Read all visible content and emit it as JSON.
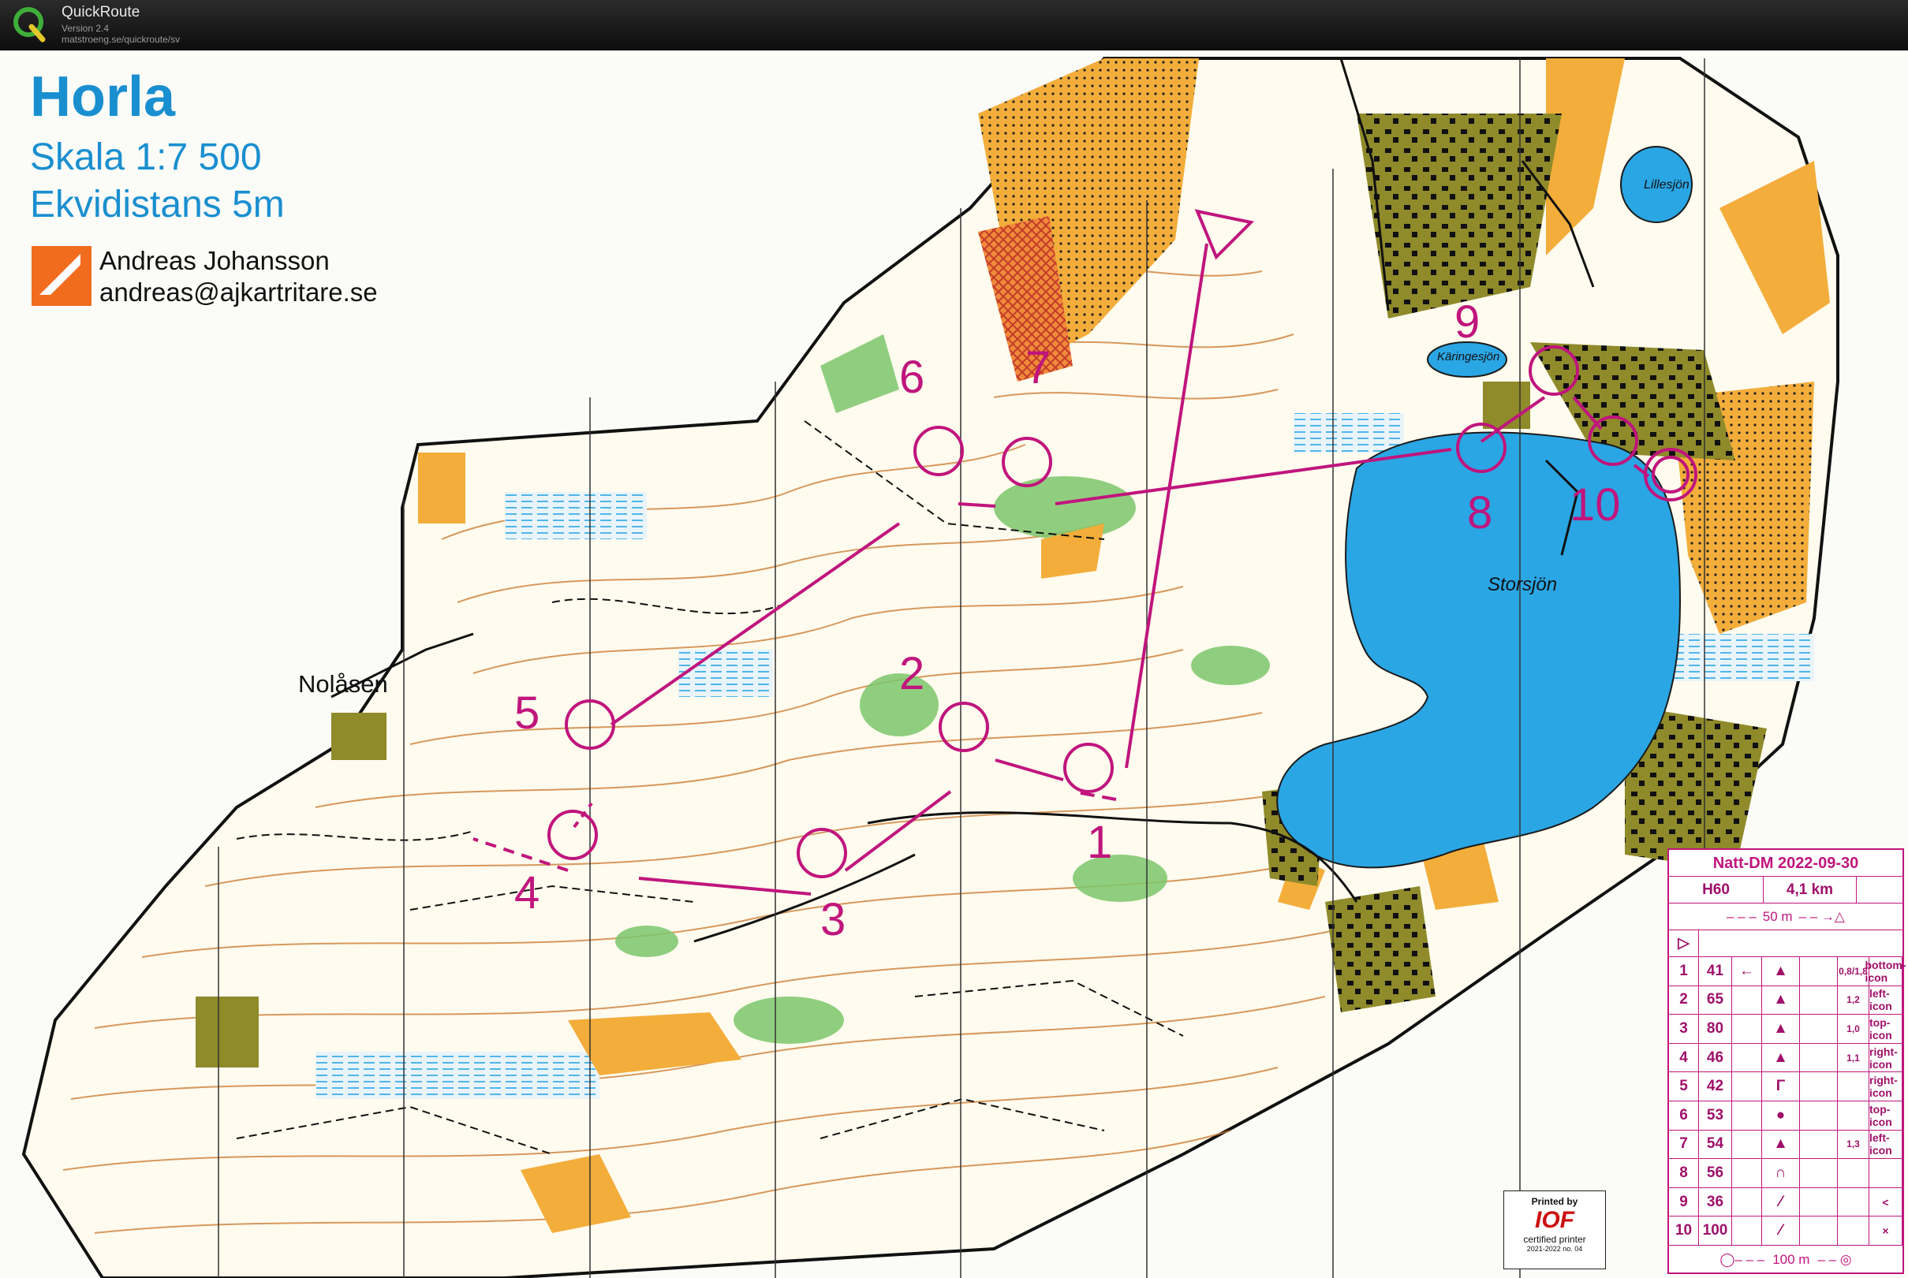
{
  "app": {
    "name": "QuickRoute",
    "version": "Version 2.4",
    "url": "matstroeng.se/quickroute/sv",
    "logo_icon": "quickroute-q-logo-icon"
  },
  "map": {
    "title": "Horla",
    "scale": "Skala 1:7 500",
    "contour_interval": "Ekvidistans 5m",
    "mapper_name": "Andreas Johansson",
    "mapper_email": "andreas@ajkartritare.se",
    "places": {
      "nolasen": "Nolåsen",
      "storsjon": "Storsjön",
      "lillesjon": "Lillesjön",
      "karringesjon": "Käringesjön"
    },
    "colors": {
      "course": "#c0157d",
      "lake": "#2aa6e4",
      "open_land": "#f2a52e",
      "vegetation": "#7cc66b",
      "contour": "#c9782d",
      "settlement": "#8f8a2a"
    },
    "controls": [
      "1",
      "2",
      "3",
      "4",
      "5",
      "6",
      "7",
      "8",
      "9",
      "10"
    ]
  },
  "description_sheet": {
    "event": "Natt-DM 2022-09-30",
    "class": "H60",
    "length": "4,1 km",
    "start_tape": "50 m",
    "finish_tape": "100 m",
    "rows": [
      {
        "num": "1",
        "code": "41",
        "dir": "←",
        "feature": "▲",
        "dim": "0,8/1,8",
        "pos": "bottom-icon"
      },
      {
        "num": "2",
        "code": "65",
        "dir": "",
        "feature": "▲",
        "dim": "1,2",
        "pos": "left-icon"
      },
      {
        "num": "3",
        "code": "80",
        "dir": "",
        "feature": "▲",
        "dim": "1,0",
        "pos": "top-icon"
      },
      {
        "num": "4",
        "code": "46",
        "dir": "",
        "feature": "▲",
        "dim": "1,1",
        "pos": "right-icon"
      },
      {
        "num": "5",
        "code": "42",
        "dir": "",
        "feature": "Γ",
        "dim": "",
        "pos": "right-icon"
      },
      {
        "num": "6",
        "code": "53",
        "dir": "",
        "feature": "●",
        "dim": "",
        "pos": "top-icon"
      },
      {
        "num": "7",
        "code": "54",
        "dir": "",
        "feature": "▲",
        "dim": "1,3",
        "pos": "left-icon"
      },
      {
        "num": "8",
        "code": "56",
        "dir": "",
        "feature": "∩",
        "dim": "",
        "pos": ""
      },
      {
        "num": "9",
        "code": "36",
        "dir": "",
        "feature": "⁄",
        "dim": "",
        "pos": "<"
      },
      {
        "num": "10",
        "code": "100",
        "dir": "",
        "feature": "⁄",
        "dim": "",
        "pos": "×"
      }
    ]
  },
  "printer_tag": {
    "printed_by": "Printed by",
    "logo": "IOF",
    "certified": "certified printer",
    "season": "2021-2022  no. 04"
  }
}
